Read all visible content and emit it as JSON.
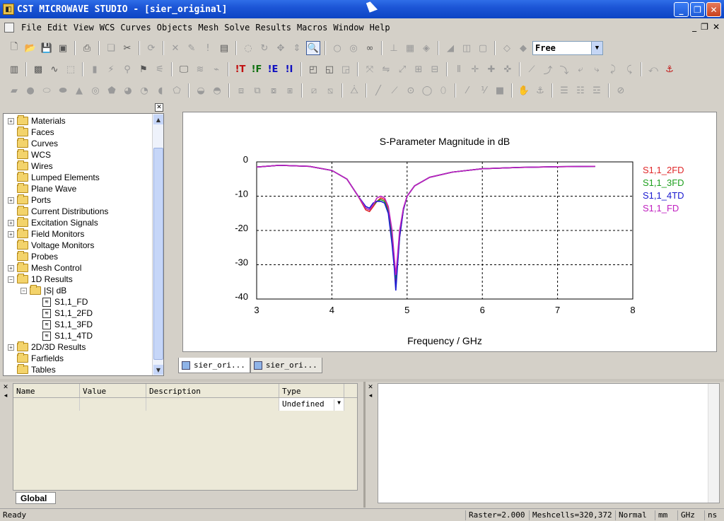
{
  "window": {
    "title": "CST MICROWAVE STUDIO - [sier_original]",
    "minimize": "_",
    "restore": "❐",
    "close": "✕"
  },
  "menu": [
    "File",
    "Edit",
    "View",
    "WCS",
    "Curves",
    "Objects",
    "Mesh",
    "Solve",
    "Results",
    "Macros",
    "Window",
    "Help"
  ],
  "mdi_controls": [
    "_",
    "❐",
    "✕"
  ],
  "toolbar": {
    "mode_select": "Free",
    "solver_labels": [
      "!T",
      "!F",
      "!E",
      "!I"
    ]
  },
  "tree": {
    "items": [
      {
        "label": "Materials",
        "expander": "+",
        "indent": 0,
        "kind": "folder"
      },
      {
        "label": "Faces",
        "expander": "",
        "indent": 0,
        "kind": "folder"
      },
      {
        "label": "Curves",
        "expander": "",
        "indent": 0,
        "kind": "folder"
      },
      {
        "label": "WCS",
        "expander": "",
        "indent": 0,
        "kind": "folder"
      },
      {
        "label": "Wires",
        "expander": "",
        "indent": 0,
        "kind": "folder"
      },
      {
        "label": "Lumped Elements",
        "expander": "",
        "indent": 0,
        "kind": "folder"
      },
      {
        "label": "Plane Wave",
        "expander": "",
        "indent": 0,
        "kind": "folder"
      },
      {
        "label": "Ports",
        "expander": "+",
        "indent": 0,
        "kind": "folder"
      },
      {
        "label": "Current Distributions",
        "expander": "",
        "indent": 0,
        "kind": "folder"
      },
      {
        "label": "Excitation Signals",
        "expander": "+",
        "indent": 0,
        "kind": "folder"
      },
      {
        "label": "Field Monitors",
        "expander": "+",
        "indent": 0,
        "kind": "folder"
      },
      {
        "label": "Voltage Monitors",
        "expander": "",
        "indent": 0,
        "kind": "folder"
      },
      {
        "label": "Probes",
        "expander": "",
        "indent": 0,
        "kind": "folder"
      },
      {
        "label": "Mesh Control",
        "expander": "+",
        "indent": 0,
        "kind": "folder"
      },
      {
        "label": "1D Results",
        "expander": "−",
        "indent": 0,
        "kind": "folder"
      },
      {
        "label": "|S| dB",
        "expander": "−",
        "indent": 1,
        "kind": "folder"
      },
      {
        "label": "S1,1_FD",
        "expander": "",
        "indent": 2,
        "kind": "curve"
      },
      {
        "label": "S1,1_2FD",
        "expander": "",
        "indent": 2,
        "kind": "curve"
      },
      {
        "label": "S1,1_3FD",
        "expander": "",
        "indent": 2,
        "kind": "curve"
      },
      {
        "label": "S1,1_4TD",
        "expander": "",
        "indent": 2,
        "kind": "curve"
      },
      {
        "label": "2D/3D Results",
        "expander": "+",
        "indent": 0,
        "kind": "folder"
      },
      {
        "label": "Farfields",
        "expander": "",
        "indent": 0,
        "kind": "folder"
      },
      {
        "label": "Tables",
        "expander": "",
        "indent": 0,
        "kind": "folder"
      }
    ]
  },
  "doc_tabs": [
    {
      "label": "sier_ori...",
      "active": true
    },
    {
      "label": "sier_ori...",
      "active": false
    }
  ],
  "params": {
    "headers": [
      "Name",
      "Value",
      "Description",
      "Type"
    ],
    "row": [
      "",
      "",
      "",
      "Undefined"
    ],
    "tab_label": "Global"
  },
  "status": {
    "ready": "Ready",
    "raster": "Raster=2.000",
    "meshcells": "Meshcells=320,372",
    "mode": "Normal",
    "unit_length": "mm",
    "unit_freq": "GHz",
    "unit_time": "ns"
  },
  "chart_data": {
    "type": "line",
    "title": "S-Parameter Magnitude in dB",
    "xlabel": "Frequency / GHz",
    "ylabel": "",
    "xlim": [
      3,
      8
    ],
    "ylim": [
      -40,
      0
    ],
    "xticks": [
      3,
      4,
      5,
      6,
      7,
      8
    ],
    "yticks": [
      0,
      -10,
      -20,
      -30,
      -40
    ],
    "grid": true,
    "legend_position": "right",
    "series": [
      {
        "name": "S1,1_2FD",
        "color": "#e0282a",
        "x": [
          3.0,
          3.3,
          3.7,
          4.0,
          4.2,
          4.35,
          4.45,
          4.5,
          4.55,
          4.6,
          4.65,
          4.7,
          4.75,
          4.8,
          4.83,
          4.85,
          4.87,
          4.9,
          4.95,
          5.0,
          5.1,
          5.3,
          5.6,
          6.0,
          6.5,
          7.0,
          7.5
        ],
        "y": [
          -1.5,
          -1.0,
          -1.3,
          -2.5,
          -5.0,
          -10.0,
          -14.0,
          -14.5,
          -13.0,
          -11.5,
          -10.5,
          -11.0,
          -14.0,
          -22.0,
          -30.0,
          -36.0,
          -30.0,
          -22.0,
          -14.0,
          -10.0,
          -7.0,
          -4.5,
          -3.0,
          -2.0,
          -1.6,
          -1.4,
          -1.3
        ]
      },
      {
        "name": "S1,1_3FD",
        "color": "#1fa01f",
        "x": [
          3.0,
          3.3,
          3.7,
          4.0,
          4.2,
          4.35,
          4.45,
          4.5,
          4.55,
          4.6,
          4.65,
          4.7,
          4.75,
          4.8,
          4.83,
          4.85,
          4.87,
          4.9,
          4.95,
          5.0,
          5.1,
          5.3,
          5.6,
          6.0,
          6.5,
          7.0,
          7.5
        ],
        "y": [
          -1.5,
          -1.0,
          -1.3,
          -2.5,
          -5.0,
          -10.0,
          -13.5,
          -14.0,
          -12.5,
          -11.5,
          -11.0,
          -11.5,
          -14.5,
          -22.0,
          -29.0,
          -34.0,
          -29.0,
          -21.0,
          -14.0,
          -10.0,
          -7.0,
          -4.5,
          -3.0,
          -2.0,
          -1.6,
          -1.4,
          -1.3
        ]
      },
      {
        "name": "S1,1_4TD",
        "color": "#1a1ad0",
        "x": [
          3.0,
          3.3,
          3.7,
          4.0,
          4.2,
          4.35,
          4.45,
          4.5,
          4.55,
          4.6,
          4.65,
          4.7,
          4.75,
          4.8,
          4.83,
          4.85,
          4.87,
          4.9,
          4.95,
          5.0,
          5.1,
          5.3,
          5.6,
          6.0,
          6.5,
          7.0,
          7.5
        ],
        "y": [
          -1.5,
          -1.0,
          -1.3,
          -2.5,
          -5.0,
          -10.0,
          -13.0,
          -13.5,
          -12.0,
          -11.5,
          -11.5,
          -12.0,
          -15.0,
          -24.0,
          -31.0,
          -37.5,
          -31.0,
          -22.0,
          -14.0,
          -10.0,
          -7.0,
          -4.5,
          -3.0,
          -2.0,
          -1.6,
          -1.4,
          -1.3
        ]
      },
      {
        "name": "S1,1_FD",
        "color": "#c020c0",
        "x": [
          3.0,
          3.3,
          3.7,
          4.0,
          4.2,
          4.35,
          4.45,
          4.5,
          4.55,
          4.6,
          4.65,
          4.7,
          4.75,
          4.8,
          4.83,
          4.85,
          4.87,
          4.9,
          4.95,
          5.0,
          5.1,
          5.3,
          5.6,
          6.0,
          6.5,
          7.0,
          7.5
        ],
        "y": [
          -1.5,
          -1.0,
          -1.3,
          -2.5,
          -5.0,
          -10.0,
          -13.5,
          -14.0,
          -12.5,
          -10.5,
          -10.0,
          -10.5,
          -13.0,
          -20.0,
          -28.0,
          -33.0,
          -28.0,
          -20.0,
          -13.5,
          -10.0,
          -7.0,
          -4.5,
          -3.0,
          -2.0,
          -1.6,
          -1.4,
          -1.3
        ]
      }
    ]
  }
}
